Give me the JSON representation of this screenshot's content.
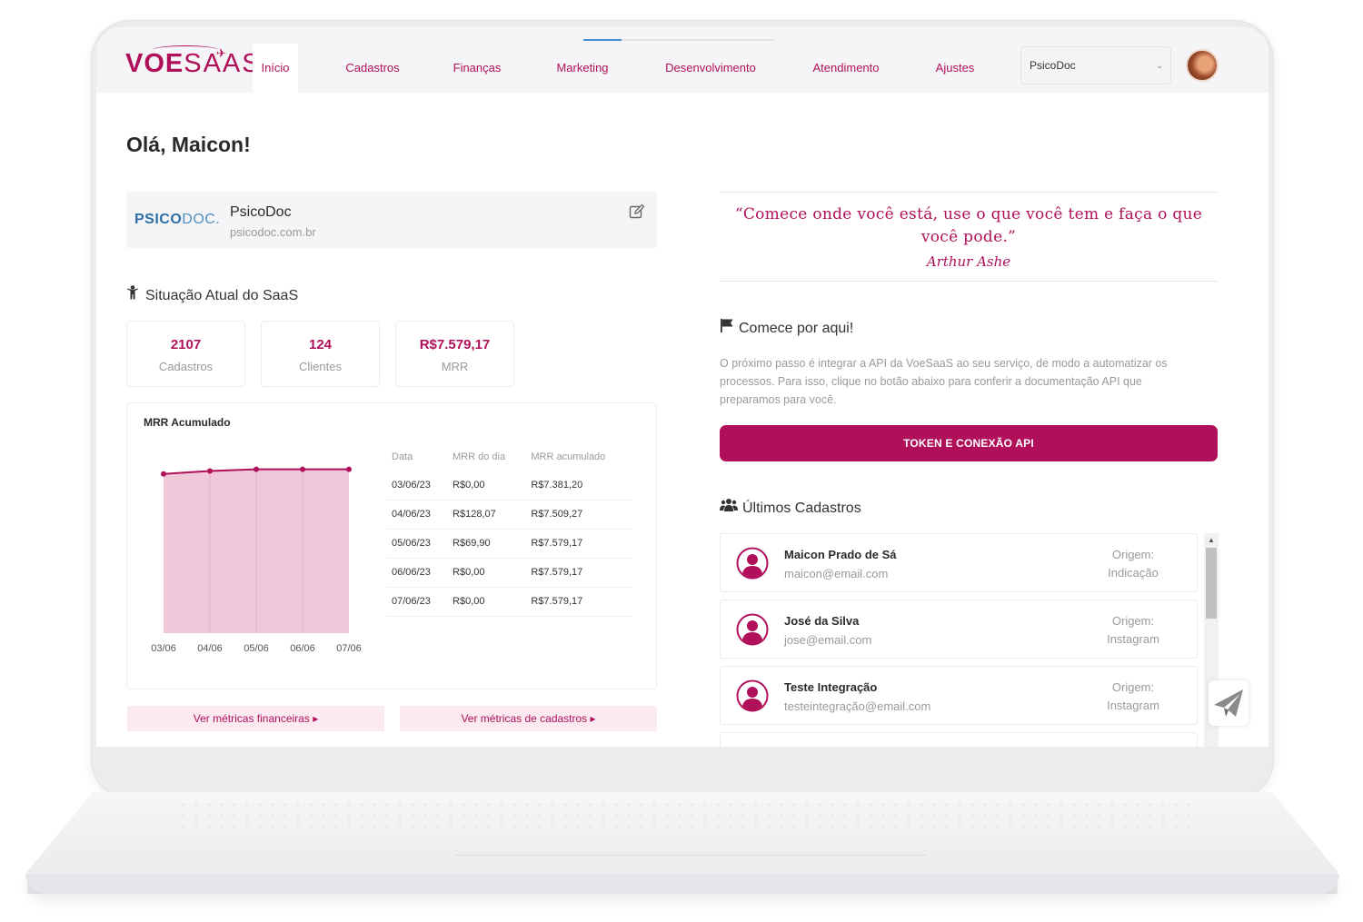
{
  "brand": {
    "logo_bold": "VOE",
    "logo_light": "SAAS",
    "accent": "#b0105a"
  },
  "nav": {
    "items": [
      {
        "label": "Início",
        "active": true
      },
      {
        "label": "Cadastros"
      },
      {
        "label": "Finanças"
      },
      {
        "label": "Marketing"
      },
      {
        "label": "Desenvolvimento"
      },
      {
        "label": "Atendimento"
      },
      {
        "label": "Ajustes"
      }
    ],
    "company_select": "PsicoDoc",
    "progress": 0.2
  },
  "greeting": "Olá, Maicon!",
  "company": {
    "logo_bold": "PSICO",
    "logo_light": "DOC.",
    "name": "PsicoDoc",
    "url": "psicodoc.com.br"
  },
  "status": {
    "title": "Situação Atual do SaaS",
    "stats": [
      {
        "value": "2107",
        "label": "Cadastros"
      },
      {
        "value": "124",
        "label": "Clientes"
      },
      {
        "value": "R$7.579,17",
        "label": "MRR"
      }
    ]
  },
  "mrr": {
    "title": "MRR Acumulado",
    "table": {
      "headers": [
        "Data",
        "MRR do dia",
        "MRR acumulado"
      ],
      "rows": [
        [
          "03/06/23",
          "R$0,00",
          "R$7.381,20"
        ],
        [
          "04/06/23",
          "R$128,07",
          "R$7.509,27"
        ],
        [
          "05/06/23",
          "R$69,90",
          "R$7.579,17"
        ],
        [
          "06/06/23",
          "R$0,00",
          "R$7.579,17"
        ],
        [
          "07/06/23",
          "R$0,00",
          "R$7.579,17"
        ]
      ]
    }
  },
  "chart_data": {
    "type": "area",
    "categories": [
      "03/06",
      "04/06",
      "05/06",
      "06/06",
      "07/06"
    ],
    "values": [
      7381.2,
      7509.27,
      7579.17,
      7579.17,
      7579.17
    ],
    "title": "MRR Acumulado",
    "xlabel": "",
    "ylabel": "",
    "ylim": [
      0,
      8000
    ],
    "grid": false,
    "colors": {
      "fill": "#f0c8d9",
      "line": "#b0105a"
    }
  },
  "metric_buttons": {
    "financial": "Ver métricas financeiras",
    "registrations": "Ver métricas de cadastros"
  },
  "quote": {
    "text": "“Comece onde você está, use o que você tem e faça o que você pode.”",
    "author": "Arthur Ashe"
  },
  "start": {
    "title": "Comece por aqui!",
    "text": "O próximo passo é integrar a API da VoeSaaS ao seu serviço, de modo a automatizar os processos. Para isso, clique no botão abaixo para conferir a documentação API que preparamos para você.",
    "button": "TOKEN E CONEXÃO API"
  },
  "recent": {
    "title": "Últimos Cadastros",
    "users": [
      {
        "name": "Maicon Prado de Sá",
        "email": "maicon@email.com",
        "origin_label": "Origem:",
        "origin": "Indicação"
      },
      {
        "name": "José da Silva",
        "email": "jose@email.com",
        "origin_label": "Origem:",
        "origin": "Instagram"
      },
      {
        "name": "Teste Integração",
        "email": "testeintegração@email.com",
        "origin_label": "Origem:",
        "origin": "Instagram"
      }
    ]
  }
}
